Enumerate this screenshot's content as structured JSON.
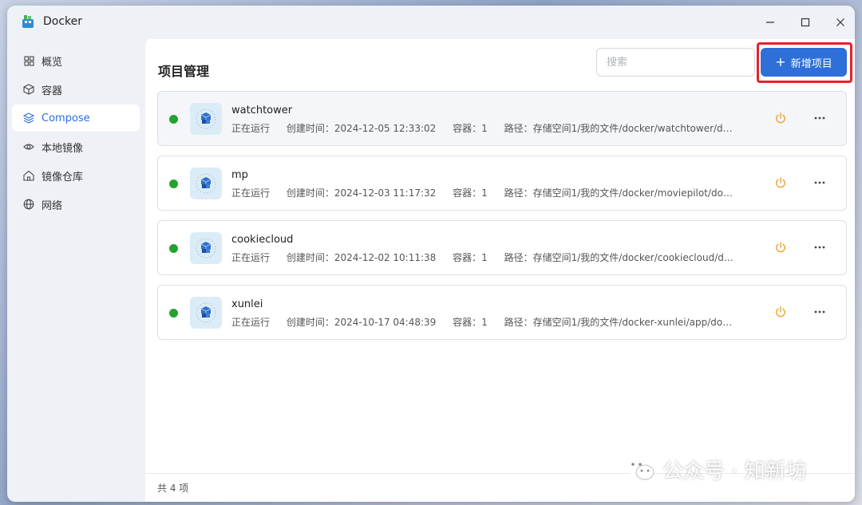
{
  "window": {
    "title": "Docker",
    "controls": {
      "minimize": "–",
      "maximize": "☐",
      "close": "✕"
    }
  },
  "sidebar": {
    "items": [
      {
        "label": "概览",
        "icon": "grid-icon",
        "active": false
      },
      {
        "label": "容器",
        "icon": "cube-icon",
        "active": false
      },
      {
        "label": "Compose",
        "icon": "layers-icon",
        "active": true
      },
      {
        "label": "本地镜像",
        "icon": "eye-icon",
        "active": false
      },
      {
        "label": "镜像仓库",
        "icon": "home-icon",
        "active": false
      },
      {
        "label": "网络",
        "icon": "globe-icon",
        "active": false
      }
    ]
  },
  "main": {
    "title": "项目管理",
    "search": {
      "placeholder": "搜索",
      "value": ""
    },
    "add_button": {
      "icon": "+",
      "label": "新增项目"
    },
    "projects": [
      {
        "name": "watchtower",
        "status": "正在运行",
        "created": "创建时间：2024-12-05 12:33:02",
        "containers": "容器：1",
        "path": "路径：存储空间1/我的文件/docker/watchtower/docker-..."
      },
      {
        "name": "mp",
        "status": "正在运行",
        "created": "创建时间：2024-12-03 11:17:32",
        "containers": "容器：1",
        "path": "路径：存储空间1/我的文件/docker/moviepilot/docker-c..."
      },
      {
        "name": "cookiecloud",
        "status": "正在运行",
        "created": "创建时间：2024-12-02 10:11:38",
        "containers": "容器：1",
        "path": "路径：存储空间1/我的文件/docker/cookiecloud/docker-..."
      },
      {
        "name": "xunlei",
        "status": "正在运行",
        "created": "创建时间：2024-10-17 04:48:39",
        "containers": "容器：1",
        "path": "路径：存储空间1/我的文件/docker-xunlei/app/docker-c..."
      }
    ],
    "footer": "共 4 项"
  },
  "colors": {
    "accent": "#2e6fd8",
    "running": "#23a32d",
    "power": "#f0a030",
    "highlight": "#e4232b"
  },
  "watermark": "公众号 · 知新坊"
}
